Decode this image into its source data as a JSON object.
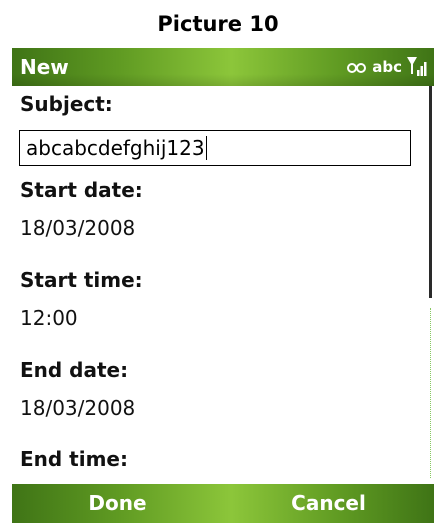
{
  "caption": "Picture 10",
  "title_bar": {
    "title": "New",
    "input_mode": "abc",
    "icons": [
      "link-icon",
      "signal-icon"
    ]
  },
  "form": {
    "subject_label": "Subject:",
    "subject_value": "abcabcdefghij123",
    "start_date_label": "Start date:",
    "start_date_value": "18/03/2008",
    "start_time_label": "Start time:",
    "start_time_value": "12:00",
    "end_date_label": "End date:",
    "end_date_value": "18/03/2008",
    "end_time_label": "End time:"
  },
  "softkeys": {
    "left": "Done",
    "right": "Cancel"
  },
  "colors": {
    "bar_dark": "#3f7416",
    "bar_light": "#8cc63a"
  }
}
